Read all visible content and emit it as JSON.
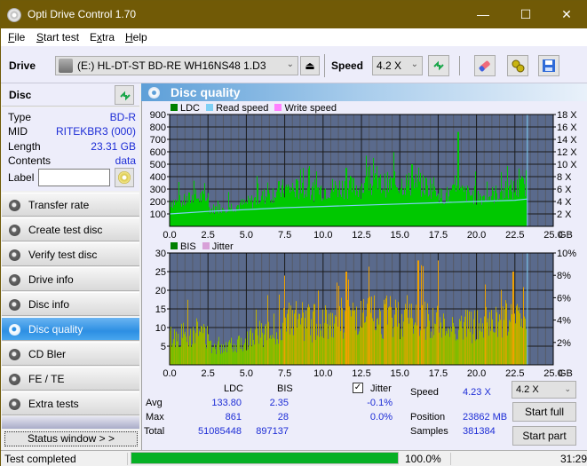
{
  "titlebar": {
    "title": "Opti Drive Control 1.70",
    "minimize": "—",
    "maximize": "☐",
    "close": "✕"
  },
  "menu": [
    {
      "label": "File",
      "mnemonic": "F",
      "rest": "ile"
    },
    {
      "label": "Start test",
      "mnemonic": "S",
      "rest": "tart test"
    },
    {
      "label": "Extra",
      "mnemonic": "x",
      "pre": "E",
      "rest": "tra"
    },
    {
      "label": "Help",
      "mnemonic": "H",
      "rest": "elp"
    }
  ],
  "toolbar": {
    "drive_label": "Drive",
    "drive_value": "(E:)  HL-DT-ST BD-RE  WH16NS48 1.D3",
    "speed_label": "Speed",
    "speed_value": "4.2 X",
    "icons": [
      "refresh-icon",
      "eraser-icon",
      "settings-icon",
      "save-icon"
    ]
  },
  "disc": {
    "header": "Disc",
    "rows": [
      {
        "key": "Type",
        "value": "BD-R"
      },
      {
        "key": "MID",
        "value": "RITEKBR3 (000)"
      },
      {
        "key": "Length",
        "value": "23.31 GB"
      },
      {
        "key": "Contents",
        "value": "data"
      }
    ],
    "label_key": "Label",
    "label_value": ""
  },
  "nav": [
    {
      "label": "Transfer rate",
      "active": false
    },
    {
      "label": "Create test disc",
      "active": false
    },
    {
      "label": "Verify test disc",
      "active": false
    },
    {
      "label": "Drive info",
      "active": false
    },
    {
      "label": "Disc info",
      "active": false
    },
    {
      "label": "Disc quality",
      "active": true
    },
    {
      "label": "CD Bler",
      "active": false
    },
    {
      "label": "FE / TE",
      "active": false
    },
    {
      "label": "Extra tests",
      "active": false
    }
  ],
  "status_window_button": "Status window > >",
  "main": {
    "title": "Disc quality"
  },
  "colors": {
    "ldc": "#00c800",
    "read_speed": "#7fd0f5",
    "write_speed": "#ff80ff",
    "bis": "#008000",
    "jitter": "#d8a0d8",
    "plot_bg": "#5a6a8c",
    "accent_blue": "#1d2dd6",
    "progress": "#06b025"
  },
  "chart_data": [
    {
      "type": "area",
      "title": "LDC",
      "legend": [
        "LDC",
        "Read speed",
        "Write speed"
      ],
      "legend_placement": "top-left",
      "xlabel": "GB",
      "x_ticks": [
        "0.0",
        "2.5",
        "5.0",
        "7.5",
        "10.0",
        "12.5",
        "15.0",
        "17.5",
        "20.0",
        "22.5",
        "25.0"
      ],
      "xlim": [
        0,
        25
      ],
      "ylim_left": [
        0,
        900
      ],
      "y_ticks_left": [
        "100",
        "200",
        "300",
        "400",
        "500",
        "600",
        "700",
        "800",
        "900"
      ],
      "ylim_right": [
        0,
        18
      ],
      "y_ticks_right": [
        "2 X",
        "4 X",
        "6 X",
        "8 X",
        "10 X",
        "12 X",
        "14 X",
        "16 X",
        "18 X"
      ],
      "grid": true,
      "end_marker_x": 23.31,
      "series": [
        {
          "name": "LDC",
          "x": [
            0,
            0.5,
            1.0,
            1.5,
            2.0,
            2.4,
            2.6,
            3.0,
            3.5,
            4.0,
            4.5,
            5.0,
            5.5,
            6.0,
            6.5,
            7.0,
            7.5,
            8.0,
            8.5,
            9.0,
            9.5,
            10.0,
            10.5,
            11.0,
            11.5,
            12.0,
            12.5,
            13.0,
            13.5,
            14.0,
            14.5,
            15.0,
            15.5,
            16.0,
            16.5,
            17.0,
            17.5,
            17.6,
            18.0,
            18.5,
            19.0,
            19.5,
            20.0,
            20.5,
            21.0,
            21.5,
            22.0,
            22.5,
            23.0,
            23.31
          ],
          "values": [
            260,
            240,
            250,
            290,
            290,
            280,
            170,
            180,
            190,
            200,
            210,
            230,
            260,
            290,
            320,
            350,
            370,
            380,
            370,
            360,
            360,
            370,
            380,
            390,
            400,
            390,
            400,
            410,
            420,
            420,
            420,
            430,
            430,
            420,
            410,
            400,
            390,
            300,
            310,
            330,
            340,
            320,
            310,
            300,
            310,
            340,
            360,
            370,
            400,
            460
          ]
        },
        {
          "name": "Read speed",
          "unit": "X",
          "x": [
            0,
            2.5,
            5.0,
            7.5,
            10.0,
            12.5,
            15.0,
            17.5,
            20.0,
            22.5,
            23.31
          ],
          "values": [
            2.0,
            2.4,
            2.7,
            3.0,
            3.2,
            3.4,
            3.6,
            3.8,
            4.0,
            4.2,
            4.4
          ]
        }
      ],
      "peaks": [
        {
          "x": 18.8,
          "value": 760
        },
        {
          "x": 15.8,
          "value": 500
        },
        {
          "x": 11.5,
          "value": 470
        }
      ]
    },
    {
      "type": "bar",
      "title": "BIS",
      "legend": [
        "BIS",
        "Jitter"
      ],
      "legend_placement": "top-left",
      "xlabel": "GB",
      "x_ticks": [
        "0.0",
        "2.5",
        "5.0",
        "7.5",
        "10.0",
        "12.5",
        "15.0",
        "17.5",
        "20.0",
        "22.5",
        "25.0"
      ],
      "xlim": [
        0,
        25
      ],
      "ylim_left": [
        0,
        30
      ],
      "y_ticks_left": [
        "5",
        "10",
        "15",
        "20",
        "25",
        "30"
      ],
      "ylim_right": [
        0,
        10
      ],
      "y_ticks_right": [
        "2%",
        "4%",
        "6%",
        "8%",
        "10%"
      ],
      "grid": true,
      "end_marker_x": 23.31,
      "series": [
        {
          "name": "BIS",
          "x": [
            0,
            0.5,
            1.0,
            1.5,
            2.0,
            2.4,
            2.6,
            3.0,
            3.5,
            4.0,
            4.5,
            5.0,
            5.5,
            6.0,
            6.5,
            7.0,
            7.5,
            8.0,
            8.5,
            9.0,
            9.5,
            10.0,
            10.5,
            11.0,
            11.5,
            12.0,
            12.5,
            13.0,
            13.5,
            14.0,
            14.5,
            15.0,
            15.5,
            16.0,
            16.5,
            17.0,
            17.5,
            17.6,
            18.0,
            18.5,
            19.0,
            19.5,
            20.0,
            20.5,
            21.0,
            21.5,
            22.0,
            22.5,
            23.0,
            23.31
          ],
          "values": [
            10,
            10,
            11,
            12,
            12,
            11,
            7,
            7,
            7,
            8,
            8,
            9,
            10,
            11,
            12,
            13,
            15,
            16,
            16,
            15,
            15,
            16,
            16,
            16,
            17,
            17,
            16,
            17,
            17,
            17,
            17,
            17,
            18,
            17,
            17,
            16,
            15,
            13,
            13,
            14,
            14,
            14,
            14,
            14,
            15,
            15,
            16,
            16,
            16,
            17
          ]
        }
      ],
      "peaks": [
        {
          "x": 16.2,
          "value": 28
        },
        {
          "x": 17.5,
          "value": 28
        },
        {
          "x": 22.4,
          "value": 25
        },
        {
          "x": 11.5,
          "value": 25
        }
      ]
    }
  ],
  "stats": {
    "col_ldc": "LDC",
    "col_bis": "BIS",
    "jitter_label": "Jitter",
    "jitter_checked": true,
    "rows": [
      {
        "label": "Avg",
        "ldc": "133.80",
        "bis": "2.35",
        "jitter": "-0.1%"
      },
      {
        "label": "Max",
        "ldc": "861",
        "bis": "28",
        "jitter": "0.0%"
      },
      {
        "label": "Total",
        "ldc": "51085448",
        "bis": "897137"
      }
    ],
    "speed_label": "Speed",
    "speed_value": "4.23 X",
    "speed_select": "4.2 X",
    "position_label": "Position",
    "position_value": "23862 MB",
    "samples_label": "Samples",
    "samples_value": "381384",
    "start_full": "Start full",
    "start_part": "Start part"
  },
  "statusbar": {
    "status": "Test completed",
    "progress": 1.0,
    "progress_text": "100.0%",
    "time": "31:29"
  }
}
